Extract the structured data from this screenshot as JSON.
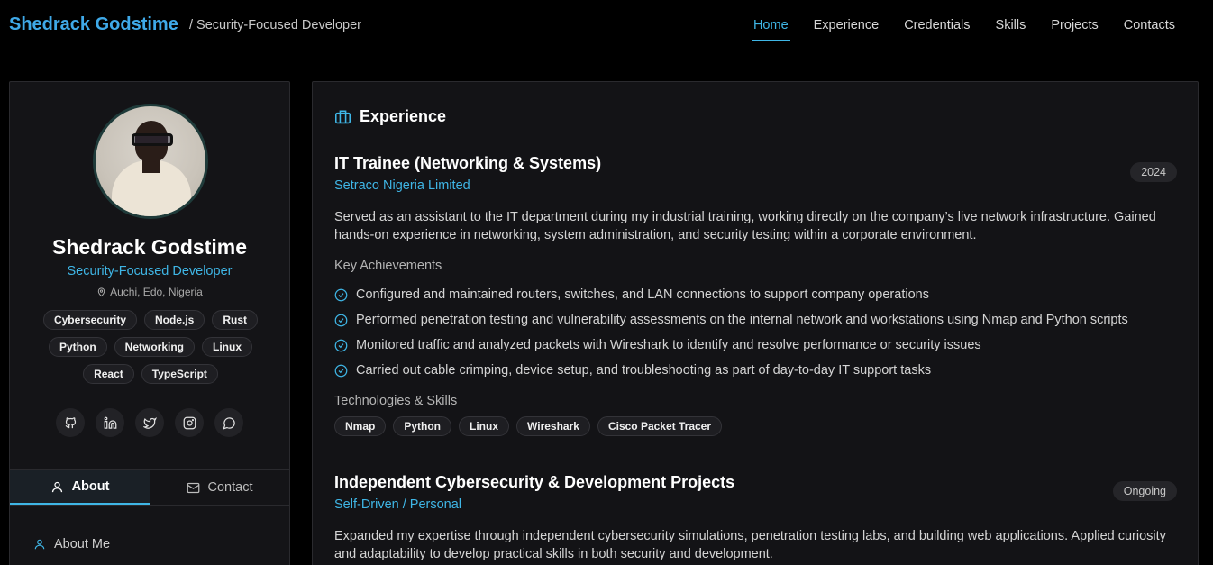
{
  "header": {
    "brand": "Shedrack Godstime",
    "tagline": "/ Security-Focused Developer",
    "nav": [
      {
        "label": "Home",
        "active": true
      },
      {
        "label": "Experience",
        "active": false
      },
      {
        "label": "Credentials",
        "active": false
      },
      {
        "label": "Skills",
        "active": false
      },
      {
        "label": "Projects",
        "active": false
      },
      {
        "label": "Contacts",
        "active": false
      }
    ]
  },
  "profile": {
    "name": "Shedrack Godstime",
    "role": "Security-Focused Developer",
    "location": "Auchi, Edo, Nigeria",
    "tags": [
      "Cybersecurity",
      "Node.js",
      "Rust",
      "Python",
      "Networking",
      "Linux",
      "React",
      "TypeScript"
    ],
    "socials": [
      "github-icon",
      "linkedin-icon",
      "twitter-icon",
      "instagram-icon",
      "whatsapp-icon"
    ],
    "tabs": [
      {
        "label": "About",
        "icon": "user-icon",
        "active": true
      },
      {
        "label": "Contact",
        "icon": "mail-icon",
        "active": false
      }
    ],
    "about_heading": "About Me"
  },
  "experience": {
    "title": "Experience",
    "jobs": [
      {
        "title": "IT Trainee (Networking & Systems)",
        "company": "Setraco Nigeria Limited",
        "badge": "2024",
        "description": "Served as an assistant to the IT department during my industrial training, working directly on the company’s live network infrastructure. Gained hands-on experience in networking, system administration, and security testing within a corporate environment.",
        "achievements_label": "Key Achievements",
        "achievements": [
          "Configured and maintained routers, switches, and LAN connections to support company operations",
          "Performed penetration testing and vulnerability assessments on the internal network and workstations using Nmap and Python scripts",
          "Monitored traffic and analyzed packets with Wireshark to identify and resolve performance or security issues",
          "Carried out cable crimping, device setup, and troubleshooting as part of day-to-day IT support tasks"
        ],
        "tech_label": "Technologies & Skills",
        "techs": [
          "Nmap",
          "Python",
          "Linux",
          "Wireshark",
          "Cisco Packet Tracer"
        ]
      },
      {
        "title": "Independent Cybersecurity & Development Projects",
        "company": "Self-Driven / Personal",
        "badge": "Ongoing",
        "description": "Expanded my expertise through independent cybersecurity simulations, penetration testing labs, and building web applications. Applied curiosity and adaptability to develop practical skills in both security and development."
      }
    ]
  },
  "colors": {
    "accent": "#3fb6e6",
    "brand": "#3fa9e8",
    "background": "#000000",
    "panel": "#131316"
  }
}
